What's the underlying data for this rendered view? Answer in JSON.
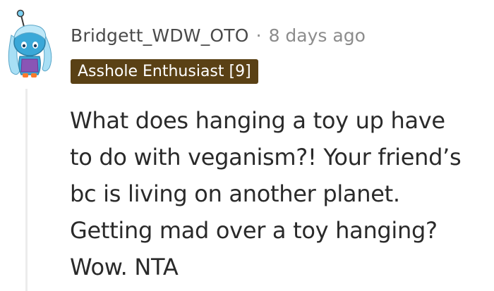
{
  "comment": {
    "author": "Bridgett_WDW_OTO",
    "separator": "·",
    "timestamp": "8 days ago",
    "flair": "Asshole Enthusiast [9]",
    "body_lines": [
      "What does hanging a toy up have",
      "to do with veganism?! Your friend’s",
      "bc is living on another planet.",
      "Getting mad over a toy hanging?",
      "Wow. NTA"
    ],
    "avatar_icon": "snoo-avatar-icon",
    "colors": {
      "flair_background": "#5a4115",
      "flair_text": "#ffffff",
      "username": "#4a4a4a",
      "timestamp": "#8c8c8c",
      "body": "#2a2a2a",
      "avatar_hair": "#a8dff5",
      "avatar_body": "#3aa8d8",
      "avatar_shirt": "#8a55b5"
    }
  }
}
